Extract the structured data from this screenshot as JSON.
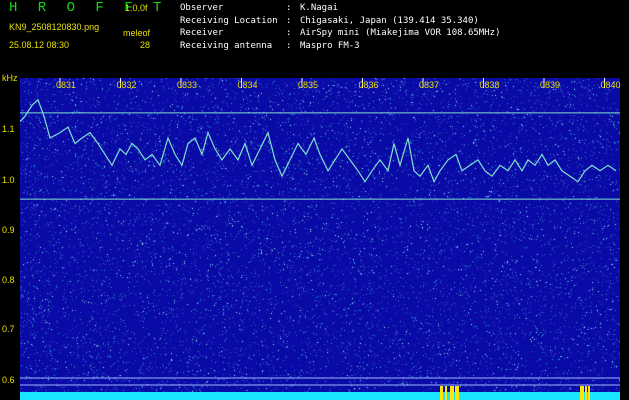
{
  "header": {
    "logo": "H R O F F T",
    "version": "1.0.0f",
    "filename": "KN9_2508120830.png",
    "site_code": "meleof",
    "datetime": "25.08.12 08:30",
    "number": "28",
    "info": [
      {
        "key": "Observer",
        "value": "K.Nagai"
      },
      {
        "key": "Receiving Location",
        "value": "Chigasaki, Japan (139.414 35.340)"
      },
      {
        "key": "Receiver",
        "value": "AirSpy mini (Miakejima VOR 108.65MHz)"
      },
      {
        "key": "Receiving antenna",
        "value": "Maspro FM-3"
      }
    ]
  },
  "colors": {
    "background": "#0a0aa6",
    "text": "#e8e000",
    "trace": "#7fe0d0",
    "logo": "#12d814",
    "floor": "#18e6ff"
  },
  "chart_data": {
    "type": "heatmap",
    "ylabel": "kHz",
    "y_ticks": [
      "1.1",
      "1.0",
      "0.9",
      "0.8",
      "0.7",
      "0.6"
    ],
    "x_ticks": [
      "0831",
      "0832",
      "0833",
      "0834",
      "0835",
      "0836",
      "0837",
      "0838",
      "0839",
      "0840"
    ],
    "ylim": [
      0.58,
      1.17
    ],
    "lines": [
      {
        "freq": 1.106,
        "type": "horizontal"
      },
      {
        "freq": 0.948,
        "type": "horizontal"
      }
    ],
    "trace_points": [
      [
        0,
        1.09
      ],
      [
        5,
        1.1
      ],
      [
        12,
        1.12
      ],
      [
        18,
        1.13
      ],
      [
        24,
        1.1
      ],
      [
        30,
        1.06
      ],
      [
        40,
        1.07
      ],
      [
        48,
        1.08
      ],
      [
        55,
        1.05
      ],
      [
        62,
        1.06
      ],
      [
        70,
        1.07
      ],
      [
        78,
        1.05
      ],
      [
        85,
        1.03
      ],
      [
        92,
        1.01
      ],
      [
        100,
        1.04
      ],
      [
        106,
        1.03
      ],
      [
        112,
        1.05
      ],
      [
        118,
        1.04
      ],
      [
        125,
        1.02
      ],
      [
        132,
        1.03
      ],
      [
        140,
        1.01
      ],
      [
        148,
        1.06
      ],
      [
        155,
        1.03
      ],
      [
        162,
        1.01
      ],
      [
        168,
        1.05
      ],
      [
        175,
        1.06
      ],
      [
        182,
        1.03
      ],
      [
        188,
        1.07
      ],
      [
        195,
        1.04
      ],
      [
        202,
        1.02
      ],
      [
        210,
        1.04
      ],
      [
        218,
        1.02
      ],
      [
        225,
        1.05
      ],
      [
        232,
        1.01
      ],
      [
        240,
        1.04
      ],
      [
        248,
        1.07
      ],
      [
        255,
        1.02
      ],
      [
        262,
        0.99
      ],
      [
        270,
        1.02
      ],
      [
        278,
        1.05
      ],
      [
        286,
        1.03
      ],
      [
        294,
        1.06
      ],
      [
        300,
        1.03
      ],
      [
        308,
        1.0
      ],
      [
        315,
        1.02
      ],
      [
        322,
        1.04
      ],
      [
        330,
        1.02
      ],
      [
        338,
        1.0
      ],
      [
        345,
        0.98
      ],
      [
        352,
        1.0
      ],
      [
        360,
        1.02
      ],
      [
        368,
        1.0
      ],
      [
        374,
        1.05
      ],
      [
        380,
        1.01
      ],
      [
        388,
        1.06
      ],
      [
        394,
        1.0
      ],
      [
        400,
        0.99
      ],
      [
        408,
        1.01
      ],
      [
        414,
        0.98
      ],
      [
        420,
        1.0
      ],
      [
        428,
        1.02
      ],
      [
        436,
        1.03
      ],
      [
        442,
        1.0
      ],
      [
        450,
        1.01
      ],
      [
        458,
        1.02
      ],
      [
        465,
        1.0
      ],
      [
        472,
        0.99
      ],
      [
        480,
        1.01
      ],
      [
        488,
        1.0
      ],
      [
        495,
        1.02
      ],
      [
        502,
        1.0
      ],
      [
        508,
        1.02
      ],
      [
        515,
        1.01
      ],
      [
        522,
        1.03
      ],
      [
        528,
        1.01
      ],
      [
        535,
        1.02
      ],
      [
        542,
        1.0
      ],
      [
        550,
        0.99
      ],
      [
        558,
        0.98
      ],
      [
        565,
        1.0
      ],
      [
        572,
        1.01
      ],
      [
        580,
        1.0
      ],
      [
        588,
        1.01
      ],
      [
        596,
        1.0
      ]
    ]
  }
}
